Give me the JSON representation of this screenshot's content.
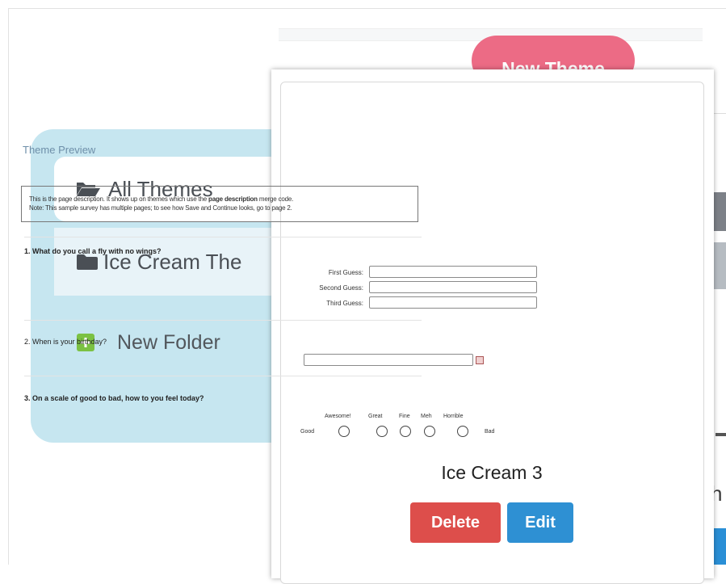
{
  "header": {
    "new_theme_label": "New Theme"
  },
  "sidebar": {
    "items": [
      {
        "label": "All Themes",
        "icon": "folder-open-icon"
      },
      {
        "label": "Ice Cream The",
        "icon": "folder-icon"
      },
      {
        "label": "New Folder",
        "icon": "plus-square-icon"
      }
    ]
  },
  "background": {
    "partial_letter": "h"
  },
  "preview": {
    "title": "Theme Preview",
    "description_line1_pre": "This is the page description. It shows up on themes which use the ",
    "description_line1_bold": "page description",
    "description_line1_post": " merge code.",
    "description_line2": "Note: This sample survey has multiple pages; to see how Save and Continue looks, go to page 2.",
    "q1": {
      "title": "1. What do you call a fly with no wings?",
      "fields": [
        "First Guess:",
        "Second Guess:",
        "Third Guess:"
      ]
    },
    "q2": {
      "title": "2. When is your birthday?"
    },
    "q3": {
      "title": "3. On a scale of good to bad, how to you feel today?",
      "options": [
        "Awesome!",
        "Great",
        "Fine",
        "Meh",
        "Horrible"
      ],
      "left_label": "Good",
      "right_label": "Bad"
    }
  },
  "theme": {
    "name": "Ice Cream 3",
    "delete_label": "Delete",
    "edit_label": "Edit"
  },
  "colors": {
    "accent_pink": "#ec6b85",
    "sidebar_blue": "#c6e6f0",
    "delete_red": "#dd4e4b",
    "edit_blue": "#2e90d3",
    "folder_green": "#7bc143"
  }
}
